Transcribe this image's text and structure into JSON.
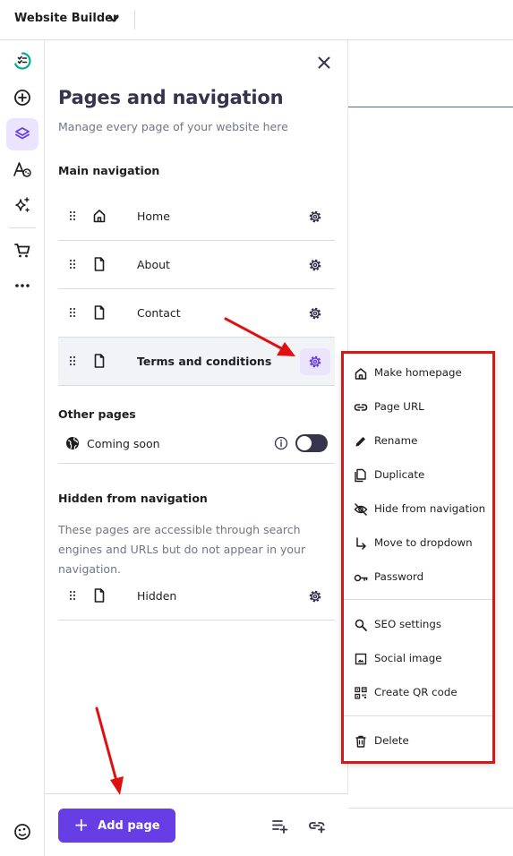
{
  "topbar": {
    "title": "Website Builder"
  },
  "panel": {
    "title": "Pages and navigation",
    "subtitle": "Manage every page of your website here",
    "main_nav_heading": "Main navigation",
    "main_nav": [
      {
        "label": "Home",
        "icon": "home-icon"
      },
      {
        "label": "About",
        "icon": "page-icon"
      },
      {
        "label": "Contact",
        "icon": "page-icon"
      },
      {
        "label": "Terms and conditions",
        "icon": "page-icon",
        "selected": true
      }
    ],
    "other_heading": "Other pages",
    "coming_soon": {
      "label": "Coming soon",
      "enabled": false
    },
    "hidden_heading": "Hidden from navigation",
    "hidden_desc": "These pages are accessible through search engines and URLs but do not appear in your navigation.",
    "hidden_pages": [
      {
        "label": "Hidden",
        "icon": "page-icon"
      }
    ],
    "add_page_label": "Add page"
  },
  "menu": {
    "items": [
      {
        "label": "Make homepage",
        "icon": "home-icon"
      },
      {
        "label": "Page URL",
        "icon": "link-icon"
      },
      {
        "label": "Rename",
        "icon": "pencil-icon"
      },
      {
        "label": "Duplicate",
        "icon": "duplicate-icon"
      },
      {
        "label": "Hide from navigation",
        "icon": "eye-off-icon"
      },
      {
        "label": "Move to dropdown",
        "icon": "arrow-down-right-icon"
      },
      {
        "label": "Password",
        "icon": "key-icon"
      },
      {
        "label": "SEO settings",
        "icon": "search-icon"
      },
      {
        "label": "Social image",
        "icon": "image-icon"
      },
      {
        "label": "Create QR code",
        "icon": "qr-code-icon"
      },
      {
        "label": "Delete",
        "icon": "trash-icon"
      }
    ]
  },
  "colors": {
    "accent": "#673de6",
    "accent_light": "#ebe4ff",
    "annotation_red": "#d31a1a",
    "brand_green": "#00b090"
  }
}
